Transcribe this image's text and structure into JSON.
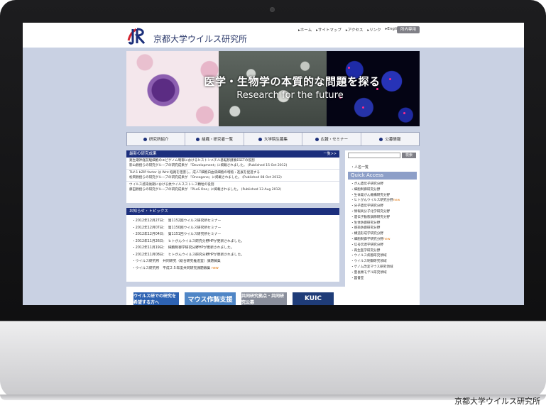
{
  "site": {
    "title": "京都大学ウイルス研究所",
    "topnav": [
      "▸ホーム",
      "▸サイトマップ",
      "▸アクセス",
      "▸リンク",
      "▸English"
    ],
    "staff_button": "所内専用"
  },
  "banner": {
    "headline_jp": "医学・生物学の本質的な問題を探る",
    "headline_en": "Research for the future"
  },
  "mainnav": [
    "研究所紹介",
    "組織・研究者一覧",
    "大学院生募集",
    "広報・セミナー",
    "公募情報"
  ],
  "latest_research": {
    "heading": "最新の研究成果",
    "more": "一覧>>",
    "items": [
      {
        "line1": "発生期神経前駆細胞のエピゲノム制御におけるヒストンメチル基転移酵素ESETの役割",
        "line2": "影山教授らの研究グループの研究成果が 『Development』に掲載されました。 (Published 15 Oct 2012)"
      },
      {
        "line1": "TLV-1 bZIP factor は Wnt 経路を阻害し，成人T細胞白血病細胞の増殖・進展を促進する",
        "line2": "松岡教授らの研究グループの研究成果が 『Oncogene』に掲載されました。 (Published 08 Oct 2012)"
      },
      {
        "line1": "ウイルス感染後期における抗ウイルスストレス顆粒の役割",
        "line2": "藤田教授らの研究グループの研究成果が 『PLoS One』に掲載されました。 (Published 13 Aug 2012)"
      }
    ]
  },
  "topics": {
    "heading": "お知らせ・トピックス",
    "items": [
      {
        "text": "・2012年12月27日：　第1152回ウイルス研究所セミナー",
        "new": ""
      },
      {
        "text": "・2012年12月07日：　第1150回ウイルス研究所セミナー",
        "new": ""
      },
      {
        "text": "・2012年12月04日：　第1151回ウイルス研究所セミナー",
        "new": ""
      },
      {
        "text": "・2012年11月26日：　ヒトがんウイルス研究分野HPが更新されました。",
        "new": ""
      },
      {
        "text": "・2012年11月19日：　細胞制御学研究分野HPが更新されました。",
        "new": ""
      },
      {
        "text": "・2012年11月08日：　ヒトがんウイルス研究分野HPが更新されました。",
        "new": ""
      },
      {
        "text": "・ウイルス研究所　共同研究（総合研究推進室）課題募集",
        "new": ""
      },
      {
        "text": "・ウイルス研究所　平成２５年度共同研究課題募集",
        "new": "new"
      }
    ]
  },
  "bottom_banners": [
    {
      "label": "ウイルス研での研究を希望する方へ",
      "color": "#2e63b3"
    },
    {
      "label": "マウス作製支援",
      "color": "#4f86c6"
    },
    {
      "label": "共同研究拠点・共同研究公募",
      "color": "#8a8f9c"
    },
    {
      "label": "KUIC",
      "color": "#1f3c78"
    }
  ],
  "sidebar": {
    "search_button": "検索",
    "people_link": "・人名一覧",
    "quick_access_heading": "Quick Access",
    "items": [
      {
        "label": "・がん遺伝子研究分野",
        "new": ""
      },
      {
        "label": "・細胞制御研究分野",
        "new": ""
      },
      {
        "label": "・生体発がん機構研究分野",
        "new": ""
      },
      {
        "label": "・ヒトがんウイルス研究分野",
        "new": "new"
      },
      {
        "label": "・分子遺伝学研究分野",
        "new": ""
      },
      {
        "label": "・情報高分子化学研究分野",
        "new": ""
      },
      {
        "label": "・遺伝子動態調節研究分野",
        "new": ""
      },
      {
        "label": "・生体防御研究分野",
        "new": ""
      },
      {
        "label": "・感染防御研究分野",
        "new": ""
      },
      {
        "label": "・構造形成学研究分野",
        "new": ""
      },
      {
        "label": "・細胞制御学研究分野",
        "new": "new"
      },
      {
        "label": "・信号伝達学研究分野",
        "new": ""
      },
      {
        "label": "・再生医学研究分野",
        "new": ""
      },
      {
        "label": "・ウイルス病態研究領域",
        "new": ""
      },
      {
        "label": "・ウイルス制御研究領域",
        "new": ""
      },
      {
        "label": "・ゲノム改変マウス研究領域",
        "new": ""
      },
      {
        "label": "・霊長類モデル研究領域",
        "new": ""
      },
      {
        "label": "・図書室",
        "new": ""
      }
    ]
  },
  "caption": "京都大学ウイルス研究所"
}
